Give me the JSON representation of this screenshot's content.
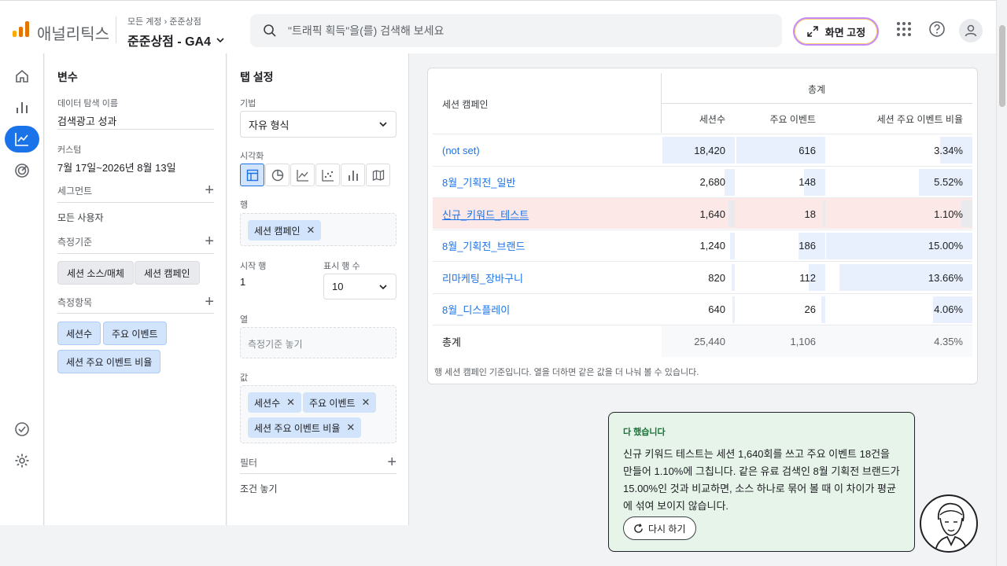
{
  "header": {
    "app_name": "애널리틱스",
    "breadcrumb_root": "모든 계정",
    "breadcrumb_account": "준준상점",
    "property_name": "준준상점 - GA4",
    "search_placeholder": "\"트래픽 획득\"을(를) 검색해 보세요",
    "pin_label": "화면 고정"
  },
  "variables_panel": {
    "title": "변수",
    "exploration_name_label": "데이터 탐색 이름",
    "exploration_name": "검색광고 성과",
    "date_label": "커스텀",
    "date_range": "7월 17일~2026년 8월 13일",
    "segments_label": "세그먼트",
    "segment_item": "모든 사용자",
    "dimensions_label": "측정기준",
    "dimensions": [
      "세션 소스/매체",
      "세션 캠페인"
    ],
    "metrics_label": "측정항목",
    "metrics": [
      "세션수",
      "주요 이벤트",
      "세션 주요 이벤트 비율"
    ]
  },
  "tab_settings": {
    "title": "탭 설정",
    "technique_label": "기법",
    "technique": "자유 형식",
    "visualization_label": "시각화",
    "rows_label": "행",
    "row_chip": "세션 캠페인",
    "start_row_label": "시작 행",
    "start_row": "1",
    "show_rows_label": "표시 행 수",
    "show_rows": "10",
    "columns_label": "열",
    "columns_placeholder": "측정기준 놓기",
    "values_label": "값",
    "value_chips": [
      "세션수",
      "주요 이벤트",
      "세션 주요 이벤트 비율"
    ],
    "filters_label": "필터",
    "filters_placeholder": "조건 놓기"
  },
  "table": {
    "group_header": "총계",
    "dimension_header": "세션 캠페인",
    "columns": [
      "세션수",
      "주요 이벤트",
      "세션 주요 이벤트 비율"
    ],
    "rows": [
      {
        "campaign": "(not set)",
        "sessions": "18,420",
        "key_events": "616",
        "rate": "3.34%"
      },
      {
        "campaign": "8월_기획전_일반",
        "sessions": "2,680",
        "key_events": "148",
        "rate": "5.52%"
      },
      {
        "campaign": "신규_키워드_테스트",
        "sessions": "1,640",
        "key_events": "18",
        "rate": "1.10%"
      },
      {
        "campaign": "8월_기획전_브랜드",
        "sessions": "1,240",
        "key_events": "186",
        "rate": "15.00%"
      },
      {
        "campaign": "리마케팅_장바구니",
        "sessions": "820",
        "key_events": "112",
        "rate": "13.66%"
      },
      {
        "campaign": "8월_디스플레이",
        "sessions": "640",
        "key_events": "26",
        "rate": "4.06%"
      }
    ],
    "total_label": "총계",
    "total": {
      "sessions": "25,440",
      "key_events": "1,106",
      "rate": "4.35%"
    },
    "footnote": "행 세션 캠페인 기준입니다. 열을 더하면 같은 값을 더 나눠 볼 수 있습니다."
  },
  "toast": {
    "title": "다 했습니다",
    "body": "신규 키워드 테스트는 세션 1,640회를 쓰고 주요 이벤트 18건을 만들어 1.10%에 그칩니다. 같은 유료 검색인 8월 기획전 브랜드가 15.00%인 것과 비교하면, 소스 하나로 묶어 볼 때 이 차이가 평균에 섞여 보이지 않습니다.",
    "retry_label": "다시 하기"
  },
  "colors": {
    "accent": "#1a73e8",
    "highlight_row": "#fce8e6",
    "toast_bg": "#e6f4ea"
  }
}
